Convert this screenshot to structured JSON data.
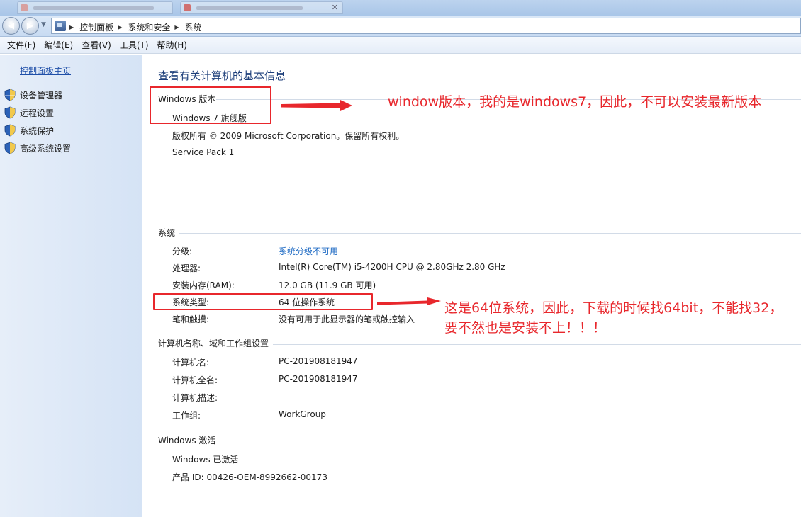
{
  "address_bar": {
    "crumbs": [
      "控制面板",
      "系统和安全",
      "系统"
    ]
  },
  "menu": [
    "文件(F)",
    "编辑(E)",
    "查看(V)",
    "工具(T)",
    "帮助(H)"
  ],
  "sidebar": {
    "home_link": "控制面板主页",
    "tasks": [
      "设备管理器",
      "远程设置",
      "系统保护",
      "高级系统设置"
    ]
  },
  "page": {
    "title": "查看有关计算机的基本信息"
  },
  "windows_edition": {
    "heading": "Windows 版本",
    "edition": "Windows 7 旗舰版",
    "copyright": "版权所有 © 2009 Microsoft Corporation。保留所有权利。",
    "service_pack": "Service Pack 1"
  },
  "system": {
    "heading": "系统",
    "rating_label": "分级:",
    "rating_value": "系统分级不可用",
    "processor_label": "处理器:",
    "processor_value": "Intel(R) Core(TM) i5-4200H CPU @ 2.80GHz   2.80 GHz",
    "ram_label": "安装内存(RAM):",
    "ram_value": "12.0 GB (11.9 GB 可用)",
    "type_label": "系统类型:",
    "type_value": "64 位操作系统",
    "pen_label": "笔和触摸:",
    "pen_value": "没有可用于此显示器的笔或触控输入"
  },
  "computer_name": {
    "heading": "计算机名称、域和工作组设置",
    "name_label": "计算机名:",
    "name_value": "PC-201908181947",
    "full_label": "计算机全名:",
    "full_value": "PC-201908181947",
    "desc_label": "计算机描述:",
    "desc_value": "",
    "workgroup_label": "工作组:",
    "workgroup_value": "WorkGroup"
  },
  "activation": {
    "heading": "Windows 激活",
    "status": "Windows 已激活",
    "product_id": "产品 ID: 00426-OEM-8992662-00173"
  },
  "annotations": {
    "note_version": "window版本，我的是windows7，因此，不可以安装最新版本",
    "note_system_type": "这是64位系统，因此，下载的时候找64bit，不能找32，要不然也是安装不上！！！",
    "color": "#e8272c"
  }
}
